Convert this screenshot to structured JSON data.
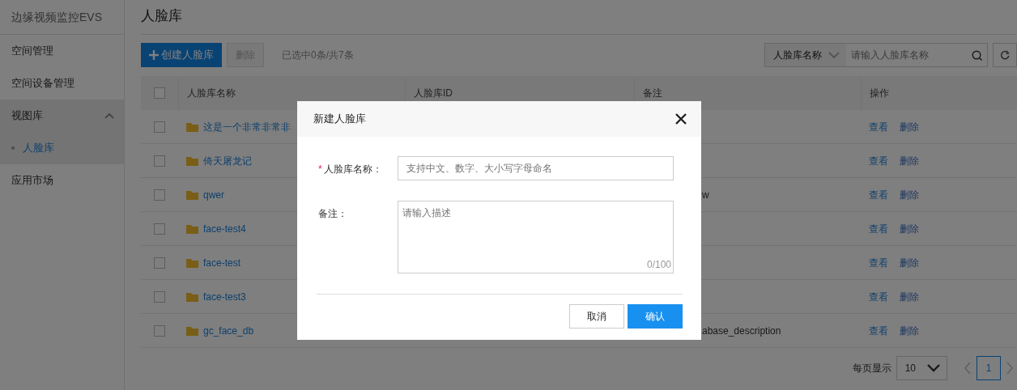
{
  "sidebar": {
    "title": "边缘视频监控EVS",
    "items": [
      {
        "label": "空间管理",
        "selected": false
      },
      {
        "label": "空间设备管理",
        "selected": false
      },
      {
        "label": "视图库",
        "selected": false,
        "expanded": true,
        "children": [
          {
            "label": "人脸库",
            "selected": true
          }
        ]
      },
      {
        "label": "应用市场",
        "selected": false
      }
    ]
  },
  "page_title": "人脸库",
  "toolbar": {
    "create_button": "创建人脸库",
    "delete_button": "删除",
    "delete_disabled": true,
    "selection_info": "已选中0条/共7条",
    "search": {
      "field_select": "人脸库名称",
      "placeholder": "请输入人脸库名称"
    }
  },
  "table": {
    "all_checked": false,
    "columns": [
      "人脸库名称",
      "人脸库ID",
      "备注",
      "操作"
    ],
    "rows": [
      {
        "checked": false,
        "name": "这是一个非常非常非",
        "actions": [
          "查看",
          "删除"
        ]
      },
      {
        "checked": false,
        "name": "倚天屠龙记",
        "actions": [
          "查看",
          "删除"
        ]
      },
      {
        "checked": false,
        "name": "qwer",
        "note": "w",
        "actions": [
          "查看",
          "删除"
        ]
      },
      {
        "checked": false,
        "name": "face-test4",
        "actions": [
          "查看",
          "删除"
        ]
      },
      {
        "checked": false,
        "name": "face-test",
        "actions": [
          "查看",
          "删除"
        ]
      },
      {
        "checked": false,
        "name": "face-test3",
        "actions": [
          "查看",
          "删除"
        ]
      },
      {
        "checked": false,
        "name": "gc_face_db",
        "note": "abase_description",
        "actions": [
          "查看",
          "删除"
        ]
      }
    ]
  },
  "pagination": {
    "page_size_label": "每页显示",
    "page_size": "10",
    "pages": [
      {
        "label": "1",
        "selected": true
      }
    ]
  },
  "dialog": {
    "title": "新建人脸库",
    "fields": [
      {
        "kind": "input",
        "required_mark": "*",
        "label": "人脸库名称：",
        "placeholder": "支持中文、数字、大小写字母命名"
      },
      {
        "kind": "textarea",
        "label": "备注：",
        "placeholder": "请输入描述",
        "counter": "0/100"
      }
    ],
    "buttons": [
      {
        "label": "取消",
        "kind": "secondary"
      },
      {
        "label": "确认",
        "kind": "primary"
      }
    ]
  }
}
